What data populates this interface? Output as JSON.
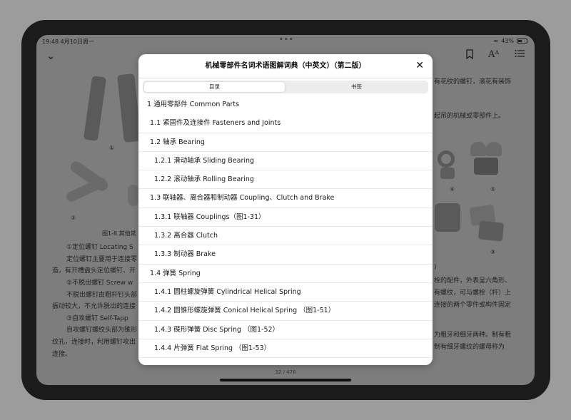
{
  "status": {
    "time": "19:48",
    "date": "4月10日周一",
    "battery": "43%"
  },
  "reader": {
    "left_lines": [
      "①定位螺钉   Locating S",
      "定位螺钉主要用于连接零",
      "造，有开槽盘头定位螺钉、开",
      "②不脱出螺钉   Screw w",
      "不脱出螺钉由粗杆钉头部",
      "振动较大，不允许脱出的连接",
      "③自攻螺钉   Self-Tapp",
      "自攻螺钉螺纹头部为锥形",
      "纹孔，连接时，利用螺钉攻出",
      "连接。"
    ],
    "figure_caption": "图1-8   其他常",
    "right_lines": [
      "有花纹的螺钉，滚花有装饰",
      "起吊的机械或零部件上。",
      ")",
      "栓的配件，外表呈六角形、",
      "有螺纹，可与螺栓（杆）上",
      "连接的两个零件或构件固定",
      "为粗牙和细牙两种。制有粗",
      "制有细牙螺纹的螺母称为"
    ],
    "figure_labels": [
      "①",
      "③",
      "④",
      "⑤",
      "⑨"
    ],
    "page_indicator": "32 / 476"
  },
  "modal": {
    "title": "机械零部件名词术语图解词典（中英文）（第二版）",
    "close_label": "✕",
    "tabs": [
      "目录",
      "书签"
    ],
    "toc": [
      {
        "level": 0,
        "text": "1 通用零部件 Common Parts"
      },
      {
        "level": 1,
        "text": "1.1 紧固件及连接件 Fasteners and Joints"
      },
      {
        "level": 1,
        "text": "1.2 轴承 Bearing"
      },
      {
        "level": 2,
        "text": "1.2.1 滑动轴承 Sliding Bearing"
      },
      {
        "level": 2,
        "text": "1.2.2 滚动轴承 Rolling Bearing"
      },
      {
        "level": 1,
        "text": "1.3 联轴器、离合器和制动器 Coupling、Clutch and Brake"
      },
      {
        "level": 2,
        "text": "1.3.1 联轴器 Couplings（图1-31）"
      },
      {
        "level": 2,
        "text": "1.3.2 离合器 Clutch"
      },
      {
        "level": 2,
        "text": "1.3.3 制动器 Brake"
      },
      {
        "level": 1,
        "text": "1.4 弹簧 Spring"
      },
      {
        "level": 2,
        "text": "1.4.1 圆柱螺旋弹簧 Cylindrical Helical Spring"
      },
      {
        "level": 2,
        "text": "1.4.2 圆锥形螺旋弹簧 Conical Helical Spring （图1-51）"
      },
      {
        "level": 2,
        "text": "1.4.3 碟形弹簧 Disc Spring （图1-52）"
      },
      {
        "level": 2,
        "text": "1.4.4 片弹簧 Flat Spring （图1-53）"
      }
    ]
  }
}
